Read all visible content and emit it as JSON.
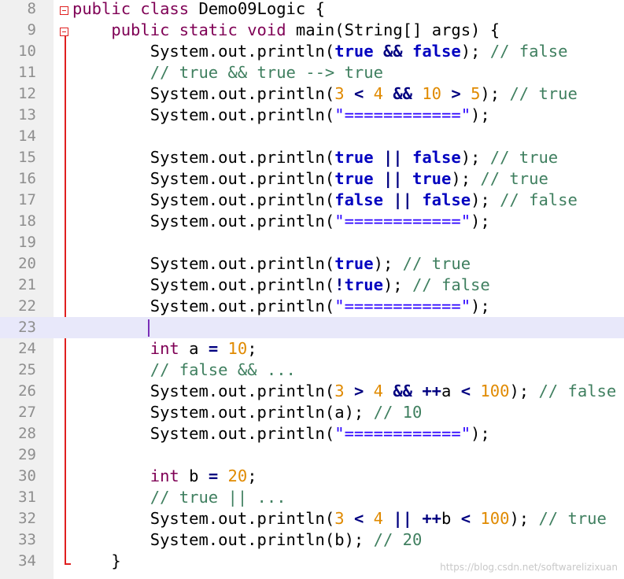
{
  "editor": {
    "language": "java",
    "current_line": 23,
    "lines": [
      {
        "n": "8",
        "tokens": [
          [
            "t-pub",
            "public"
          ],
          [
            "",
            " "
          ],
          [
            "t-pub",
            "class"
          ],
          [
            "",
            " Demo09Logic {"
          ]
        ]
      },
      {
        "n": "9",
        "tokens": [
          [
            "",
            "    "
          ],
          [
            "t-pub",
            "public"
          ],
          [
            "",
            " "
          ],
          [
            "t-pub",
            "static"
          ],
          [
            "",
            " "
          ],
          [
            "t-pub",
            "void"
          ],
          [
            "",
            " main(String[] args) {"
          ]
        ]
      },
      {
        "n": "10",
        "tokens": [
          [
            "",
            "        System.out.println("
          ],
          [
            "bool",
            "true"
          ],
          [
            "",
            " "
          ],
          [
            "op",
            "&&"
          ],
          [
            "",
            " "
          ],
          [
            "bool",
            "false"
          ],
          [
            "",
            "); "
          ],
          [
            "cmt",
            "// false"
          ]
        ]
      },
      {
        "n": "11",
        "tokens": [
          [
            "",
            "        "
          ],
          [
            "cmt",
            "// true && true --> true"
          ]
        ]
      },
      {
        "n": "12",
        "tokens": [
          [
            "",
            "        System.out.println("
          ],
          [
            "num",
            "3"
          ],
          [
            "",
            " "
          ],
          [
            "op",
            "<"
          ],
          [
            "",
            " "
          ],
          [
            "num",
            "4"
          ],
          [
            "",
            " "
          ],
          [
            "op",
            "&&"
          ],
          [
            "",
            " "
          ],
          [
            "num",
            "10"
          ],
          [
            "",
            " "
          ],
          [
            "op",
            ">"
          ],
          [
            "",
            " "
          ],
          [
            "num",
            "5"
          ],
          [
            "",
            "); "
          ],
          [
            "cmt",
            "// true"
          ]
        ]
      },
      {
        "n": "13",
        "tokens": [
          [
            "",
            "        System.out.println("
          ],
          [
            "str",
            "\"============\""
          ],
          [
            "",
            ");"
          ]
        ]
      },
      {
        "n": "14",
        "tokens": []
      },
      {
        "n": "15",
        "tokens": [
          [
            "",
            "        System.out.println("
          ],
          [
            "bool",
            "true"
          ],
          [
            "",
            " "
          ],
          [
            "op",
            "||"
          ],
          [
            "",
            " "
          ],
          [
            "bool",
            "false"
          ],
          [
            "",
            "); "
          ],
          [
            "cmt",
            "// true"
          ]
        ]
      },
      {
        "n": "16",
        "tokens": [
          [
            "",
            "        System.out.println("
          ],
          [
            "bool",
            "true"
          ],
          [
            "",
            " "
          ],
          [
            "op",
            "||"
          ],
          [
            "",
            " "
          ],
          [
            "bool",
            "true"
          ],
          [
            "",
            "); "
          ],
          [
            "cmt",
            "// true"
          ]
        ]
      },
      {
        "n": "17",
        "tokens": [
          [
            "",
            "        System.out.println("
          ],
          [
            "bool",
            "false"
          ],
          [
            "",
            " "
          ],
          [
            "op",
            "||"
          ],
          [
            "",
            " "
          ],
          [
            "bool",
            "false"
          ],
          [
            "",
            "); "
          ],
          [
            "cmt",
            "// false"
          ]
        ]
      },
      {
        "n": "18",
        "tokens": [
          [
            "",
            "        System.out.println("
          ],
          [
            "str",
            "\"============\""
          ],
          [
            "",
            ");"
          ]
        ]
      },
      {
        "n": "19",
        "tokens": []
      },
      {
        "n": "20",
        "tokens": [
          [
            "",
            "        System.out.println("
          ],
          [
            "bool",
            "true"
          ],
          [
            "",
            "); "
          ],
          [
            "cmt",
            "// true"
          ]
        ]
      },
      {
        "n": "21",
        "tokens": [
          [
            "",
            "        System.out.println("
          ],
          [
            "op",
            "!"
          ],
          [
            "bool",
            "true"
          ],
          [
            "",
            "); "
          ],
          [
            "cmt",
            "// false"
          ]
        ]
      },
      {
        "n": "22",
        "tokens": [
          [
            "",
            "        System.out.println("
          ],
          [
            "str",
            "\"============\""
          ],
          [
            "",
            ");"
          ]
        ]
      },
      {
        "n": "23",
        "tokens": []
      },
      {
        "n": "24",
        "tokens": [
          [
            "",
            "        "
          ],
          [
            "t-pub",
            "int"
          ],
          [
            "",
            " a "
          ],
          [
            "op",
            "="
          ],
          [
            "",
            " "
          ],
          [
            "num",
            "10"
          ],
          [
            "",
            ";"
          ]
        ]
      },
      {
        "n": "25",
        "tokens": [
          [
            "",
            "        "
          ],
          [
            "cmt",
            "// false && ..."
          ]
        ]
      },
      {
        "n": "26",
        "tokens": [
          [
            "",
            "        System.out.println("
          ],
          [
            "num",
            "3"
          ],
          [
            "",
            " "
          ],
          [
            "op",
            ">"
          ],
          [
            "",
            " "
          ],
          [
            "num",
            "4"
          ],
          [
            "",
            " "
          ],
          [
            "op",
            "&&"
          ],
          [
            "",
            " "
          ],
          [
            "op",
            "++"
          ],
          [
            "",
            "a "
          ],
          [
            "op",
            "<"
          ],
          [
            "",
            " "
          ],
          [
            "num",
            "100"
          ],
          [
            "",
            "); "
          ],
          [
            "cmt",
            "// false"
          ]
        ]
      },
      {
        "n": "27",
        "tokens": [
          [
            "",
            "        System.out.println(a); "
          ],
          [
            "cmt",
            "// 10"
          ]
        ]
      },
      {
        "n": "28",
        "tokens": [
          [
            "",
            "        System.out.println("
          ],
          [
            "str",
            "\"============\""
          ],
          [
            "",
            ");"
          ]
        ]
      },
      {
        "n": "29",
        "tokens": []
      },
      {
        "n": "30",
        "tokens": [
          [
            "",
            "        "
          ],
          [
            "t-pub",
            "int"
          ],
          [
            "",
            " b "
          ],
          [
            "op",
            "="
          ],
          [
            "",
            " "
          ],
          [
            "num",
            "20"
          ],
          [
            "",
            ";"
          ]
        ]
      },
      {
        "n": "31",
        "tokens": [
          [
            "",
            "        "
          ],
          [
            "cmt",
            "// true || ..."
          ]
        ]
      },
      {
        "n": "32",
        "tokens": [
          [
            "",
            "        System.out.println("
          ],
          [
            "num",
            "3"
          ],
          [
            "",
            " "
          ],
          [
            "op",
            "<"
          ],
          [
            "",
            " "
          ],
          [
            "num",
            "4"
          ],
          [
            "",
            " "
          ],
          [
            "op",
            "||"
          ],
          [
            "",
            " "
          ],
          [
            "op",
            "++"
          ],
          [
            "",
            "b "
          ],
          [
            "op",
            "<"
          ],
          [
            "",
            " "
          ],
          [
            "num",
            "100"
          ],
          [
            "",
            "); "
          ],
          [
            "cmt",
            "// true"
          ]
        ]
      },
      {
        "n": "33",
        "tokens": [
          [
            "",
            "        System.out.println(b); "
          ],
          [
            "cmt",
            "// 20"
          ]
        ]
      },
      {
        "n": "34",
        "tokens": [
          [
            "",
            "    }"
          ]
        ]
      }
    ]
  },
  "colors": {
    "keyword": "#7f0055",
    "boolean": "#0000c0",
    "number": "#e08a00",
    "comment": "#3f7f5f",
    "string": "#2a00ff",
    "fold_marker": "#e02020",
    "current_line_bg": "#e8e8fa"
  },
  "watermark": "https://blog.csdn.net/softwarelizixuan"
}
